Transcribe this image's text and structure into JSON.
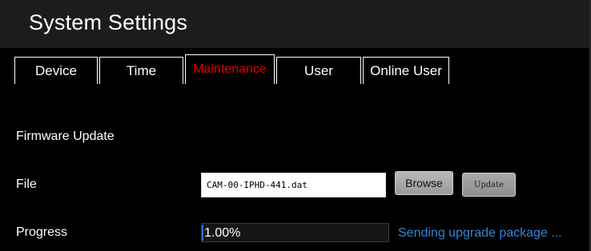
{
  "header": {
    "title": "System Settings"
  },
  "tabs": [
    {
      "label": "Device"
    },
    {
      "label": "Time"
    },
    {
      "label": "Maintenance",
      "active": true
    },
    {
      "label": "User"
    },
    {
      "label": "Online User"
    }
  ],
  "firmware": {
    "section_label": "Firmware Update",
    "file_label": "File",
    "file_value": "CAM-00-IPHD-441.dat",
    "browse_label": "Browse",
    "update_label": "Update",
    "progress_label": "Progress",
    "progress_text": "1.00%",
    "progress_fraction": 0.01,
    "status_text": "Sending upgrade package ..."
  },
  "colors": {
    "active_tab": "#e00000",
    "status_text": "#2f86d6",
    "title_bar": "#1c1c1c"
  }
}
